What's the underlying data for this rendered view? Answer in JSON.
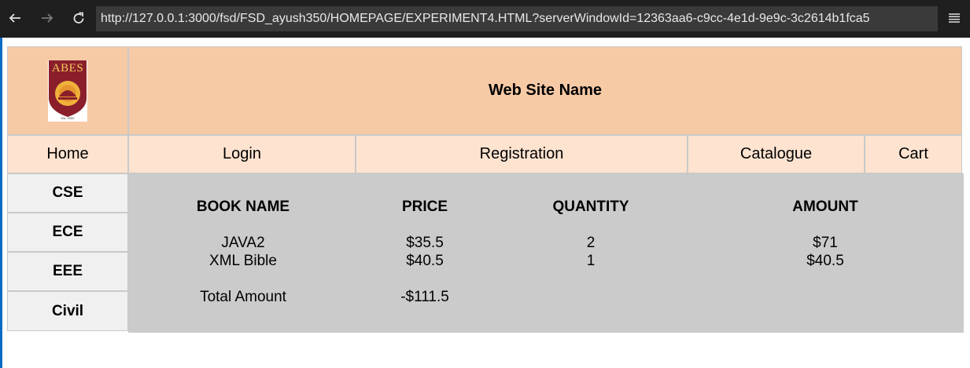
{
  "browser": {
    "url": "http://127.0.0.1:3000/fsd/FSD_ayush350/HOMEPAGE/EXPERIMENT4.HTML?serverWindowId=12363aa6-c9cc-4e1d-9e9c-3c2614b1fca5",
    "icons": [
      "back-arrow-icon",
      "forward-arrow-icon",
      "reload-icon",
      "menu-icon"
    ]
  },
  "header": {
    "logo_text": "ABES",
    "logo_caption": "Est. 2000",
    "site_name": "Web Site Name"
  },
  "nav": {
    "items": [
      "Home",
      "Login",
      "Registration",
      "Catalogue",
      "Cart"
    ]
  },
  "sidebar": {
    "items": [
      "CSE",
      "ECE",
      "EEE",
      "Civil"
    ]
  },
  "cart": {
    "headers": [
      "BOOK NAME",
      "PRICE",
      "QUANTITY",
      "AMOUNT"
    ],
    "rows": [
      [
        "JAVA2",
        "$35.5",
        "2",
        "$71"
      ],
      [
        "XML Bible",
        "$40.5",
        "1",
        "$40.5"
      ]
    ],
    "total_label": "Total Amount",
    "total_value": "-$111.5"
  },
  "colors": {
    "header_bg": "#f7caa6",
    "nav_bg": "#fde3d0",
    "sidebar_bg": "#f0f0f0",
    "content_bg": "#cbcbcb"
  }
}
